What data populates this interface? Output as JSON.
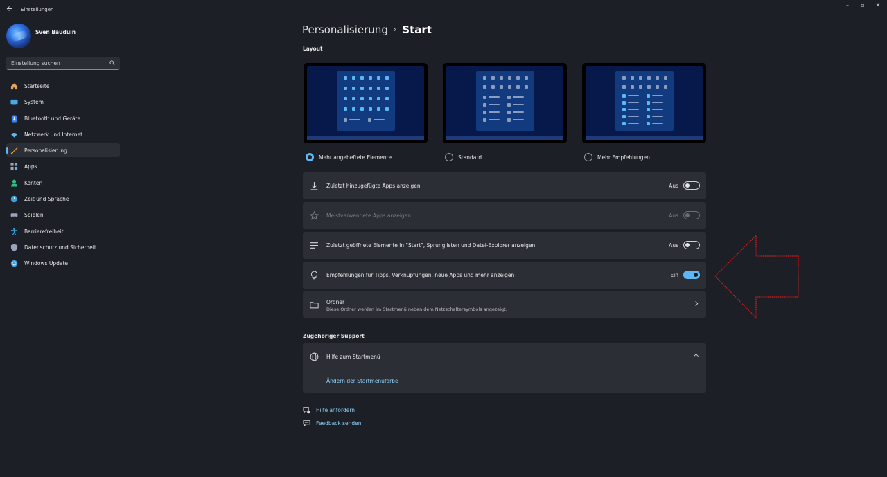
{
  "window": {
    "title": "Einstellungen",
    "back_icon": "back-arrow-icon",
    "minimize": "–",
    "maximize": "▫",
    "close": "✕"
  },
  "profile": {
    "name": "Sven Bauduin"
  },
  "search": {
    "placeholder": "Einstellung suchen"
  },
  "sidebar": {
    "items": [
      {
        "label": "Startseite",
        "icon": "home-icon",
        "color": "#e8a35a"
      },
      {
        "label": "System",
        "icon": "monitor-icon",
        "color": "#4aa8e8"
      },
      {
        "label": "Bluetooth und Geräte",
        "icon": "bluetooth-icon",
        "color": "#3b82f6"
      },
      {
        "label": "Netzwerk und Internet",
        "icon": "wifi-icon",
        "color": "#5cb7f5"
      },
      {
        "label": "Personalisierung",
        "icon": "brush-icon",
        "color": "#e58a3a"
      },
      {
        "label": "Apps",
        "icon": "apps-icon",
        "color": "#9aa4b8"
      },
      {
        "label": "Konten",
        "icon": "person-icon",
        "color": "#2ec27e"
      },
      {
        "label": "Zeit und Sprache",
        "icon": "globe-clock-icon",
        "color": "#3aa0e0"
      },
      {
        "label": "Spielen",
        "icon": "gamepad-icon",
        "color": "#9aa4b8"
      },
      {
        "label": "Barrierefreiheit",
        "icon": "accessibility-icon",
        "color": "#3aa0e0"
      },
      {
        "label": "Datenschutz und Sicherheit",
        "icon": "shield-icon",
        "color": "#9aa4b8"
      },
      {
        "label": "Windows Update",
        "icon": "update-icon",
        "color": "#3aa0e0"
      }
    ],
    "active_index": 4
  },
  "breadcrumb": {
    "parent": "Personalisierung",
    "separator": "›",
    "current": "Start"
  },
  "layout": {
    "heading": "Layout",
    "options": [
      {
        "label": "Mehr angeheftete Elemente",
        "selected": true
      },
      {
        "label": "Standard",
        "selected": false
      },
      {
        "label": "Mehr Empfehlungen",
        "selected": false
      }
    ]
  },
  "settings": [
    {
      "label": "Zuletzt hinzugefügte Apps anzeigen",
      "icon": "download-icon",
      "state": "Aus",
      "on": false,
      "disabled": false
    },
    {
      "label": "Meistverwendete Apps anzeigen",
      "icon": "star-icon",
      "state": "Aus",
      "on": false,
      "disabled": true
    },
    {
      "label": "Zuletzt geöffnete Elemente in \"Start\", Sprunglisten und Datei-Explorer anzeigen",
      "icon": "list-icon",
      "state": "Aus",
      "on": false,
      "disabled": false
    },
    {
      "label": "Empfehlungen für Tipps, Verknüpfungen, neue Apps und mehr anzeigen",
      "icon": "lightbulb-icon",
      "state": "Ein",
      "on": true,
      "disabled": false
    }
  ],
  "folders": {
    "label": "Ordner",
    "description": "Diese Ordner werden im Startmenü neben dem Netzschaltersymbols angezeigt.",
    "icon": "folder-icon"
  },
  "support": {
    "heading": "Zugehöriger Support",
    "help_label": "Hilfe zum Startmenü",
    "help_icon": "globe-icon",
    "link": "Ändern der Startmenüfarbe"
  },
  "footer_links": [
    {
      "label": "Hilfe anfordern",
      "icon": "help-chat-icon"
    },
    {
      "label": "Feedback senden",
      "icon": "feedback-icon"
    }
  ],
  "colors": {
    "accent": "#5cb7f5",
    "annotation": "#d11a1a",
    "background": "#1c1f26",
    "card": "#2b2e35"
  }
}
